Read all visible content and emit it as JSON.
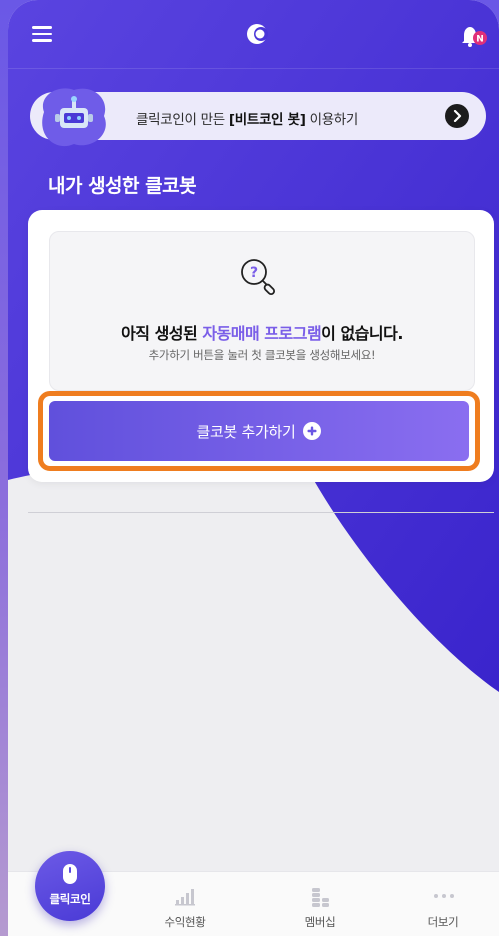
{
  "colors": {
    "brand": "#4a36d8",
    "accent": "#7a5ee8",
    "highlight": "#ef7d1f"
  },
  "header": {
    "menu_icon": "hamburger-icon",
    "logo_icon": "moon-logo-icon",
    "notification_icon": "bell-icon",
    "notification_badge": "N"
  },
  "banner": {
    "text_prefix": "클릭코인이 만든 ",
    "text_bold": "[비트코인 봇]",
    "text_suffix": " 이용하기",
    "icon": "robot-icon",
    "arrow_icon": "chevron-right-icon"
  },
  "section": {
    "title": "내가 생성한 클코봇"
  },
  "empty_state": {
    "icon": "search-question-icon",
    "title_prefix": "아직 생성된 ",
    "title_accent": "자동매매 프로그램",
    "title_suffix": "이 없습니다.",
    "subtitle": "추가하기 버튼을 눌러 첫 클코봇을 생성해보세요!"
  },
  "add_button": {
    "label": "클코봇 추가하기",
    "icon": "plus-circle-icon"
  },
  "bottom_nav": {
    "items": [
      {
        "label": "클릭코인",
        "icon": "mouse-icon",
        "active": true
      },
      {
        "label": "수익현황",
        "icon": "bar-chart-icon",
        "active": false
      },
      {
        "label": "멤버십",
        "icon": "coins-icon",
        "active": false
      },
      {
        "label": "더보기",
        "icon": "more-dots-icon",
        "active": false
      }
    ]
  }
}
